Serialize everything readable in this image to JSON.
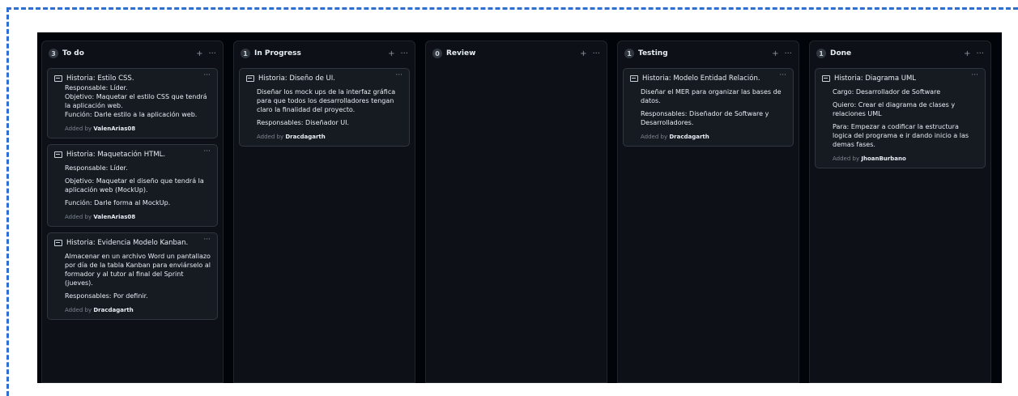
{
  "columns": [
    {
      "title": "To do",
      "count": "3",
      "cards": [
        {
          "title": "Historia: Estilo CSS.",
          "lines": [
            "Responsable: Líder.",
            "Objetivo: Maquetar el estilo CSS que tendrá la aplicación web.",
            "Función: Darle estilo a la aplicación web."
          ],
          "added_by": "ValenArias08"
        },
        {
          "title": "Historia: Maquetación HTML.",
          "lines": [
            "Responsable: Líder.",
            "Objetivo: Maquetar el diseño que tendrá la aplicación web (MockUp).",
            "Función: Darle forma al MockUp."
          ],
          "added_by": "ValenArias08"
        },
        {
          "title": "Historia: Evidencia Modelo Kanban.",
          "lines": [
            "Almacenar en un archivo Word un pantallazo por día de la tabla Kanban para enviárselo al formador y al tutor al final del Sprint (jueves).",
            "Responsables: Por definir."
          ],
          "added_by": "Dracdagarth"
        }
      ]
    },
    {
      "title": "In Progress",
      "count": "1",
      "cards": [
        {
          "title": "Historia: Diseño de UI.",
          "lines": [
            "Diseñar los mock ups de la interfaz gráfica para que todos los desarrolladores tengan claro la finalidad del proyecto.",
            "Responsables: Diseñador UI."
          ],
          "added_by": "Dracdagarth"
        }
      ]
    },
    {
      "title": "Review",
      "count": "0",
      "cards": []
    },
    {
      "title": "Testing",
      "count": "1",
      "cards": [
        {
          "title": "Historia: Modelo Entidad Relación.",
          "lines": [
            "Diseñar el MER para organizar las bases de datos.",
            "Responsables: Diseñador de Software y Desarrolladores."
          ],
          "added_by": "Dracdagarth"
        }
      ]
    },
    {
      "title": "Done",
      "count": "1",
      "cards": [
        {
          "title": "Historia: Diagrama UML",
          "lines": [
            "Cargo: Desarrollador de Software",
            "Quiero: Crear el diagrama de clases y relaciones UML",
            "Para: Empezar a codificar la estructura logica del programa e ir dando inicio a las demas fases."
          ],
          "added_by": "JhoanBurbano"
        }
      ]
    }
  ],
  "ui": {
    "add_symbol": "+",
    "more_symbol": "···",
    "added_by_prefix": "Added by"
  },
  "icons": {
    "card_type": "note-icon",
    "add": "plus-icon",
    "more": "kebab-icon"
  },
  "colors": {
    "board_bg": "#010409",
    "column_bg": "#0d1117",
    "card_bg": "#161b22",
    "border_accent": "#2f6fd1"
  }
}
